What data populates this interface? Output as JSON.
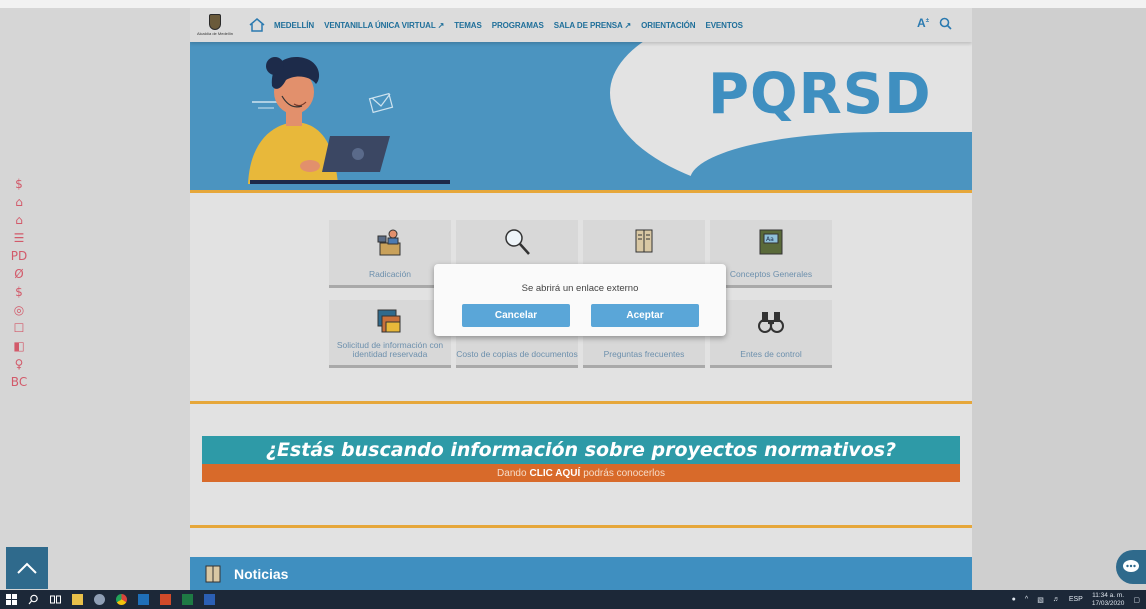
{
  "nav": {
    "logo_text": "Alcaldía de Medellín",
    "items": [
      "MEDELLÍN",
      "VENTANILLA ÚNICA VIRTUAL ↗",
      "TEMAS",
      "PROGRAMAS",
      "SALA DE PRENSA ↗",
      "ORIENTACIÓN",
      "EVENTOS"
    ],
    "font_size_icon": "A",
    "search_icon": "search-icon"
  },
  "hero": {
    "title": "PQRSD"
  },
  "tiles": [
    {
      "label": "Radicación",
      "icon": "reception-desk-icon"
    },
    {
      "label": "",
      "icon": "magnifier-icon"
    },
    {
      "label": "",
      "icon": "open-book-icon"
    },
    {
      "label": "Conceptos Generales",
      "icon": "dictionary-icon"
    },
    {
      "label": "Solicitud de información con identidad reservada",
      "icon": "files-icon"
    },
    {
      "label": "Costo de copias de documentos",
      "icon": "copy-cost-icon"
    },
    {
      "label": "Preguntas frecuentes",
      "icon": "faq-icon"
    },
    {
      "label": "Entes de control",
      "icon": "binoculars-icon"
    }
  ],
  "dialog": {
    "message": "Se abrirá un enlace externo",
    "cancel": "Cancelar",
    "accept": "Aceptar"
  },
  "banner": {
    "headline": "¿Estás buscando información sobre proyectos normativos?",
    "sub_pre": "Dando",
    "sub_bold": "CLIC AQUÍ",
    "sub_post": "podrás conocerlos"
  },
  "news": {
    "title": "Noticias"
  },
  "left_icons": [
    "$",
    "⌂",
    "⌂",
    "☰",
    "PD",
    "Ø",
    "$",
    "◎",
    "☐",
    "◧",
    "♀",
    "BC"
  ],
  "taskbar": {
    "apps": [
      "start",
      "search",
      "task-view",
      "file-explorer",
      "edge",
      "chrome",
      "outlook",
      "powerpoint",
      "excel",
      "word"
    ],
    "lang": "ESP",
    "time": "11:34 a. m.",
    "date": "17/03/2020"
  },
  "colors": {
    "accent": "#4b94c0",
    "gold": "#e6a73a",
    "teal": "#2e9aa7",
    "orange": "#d86a2a"
  }
}
